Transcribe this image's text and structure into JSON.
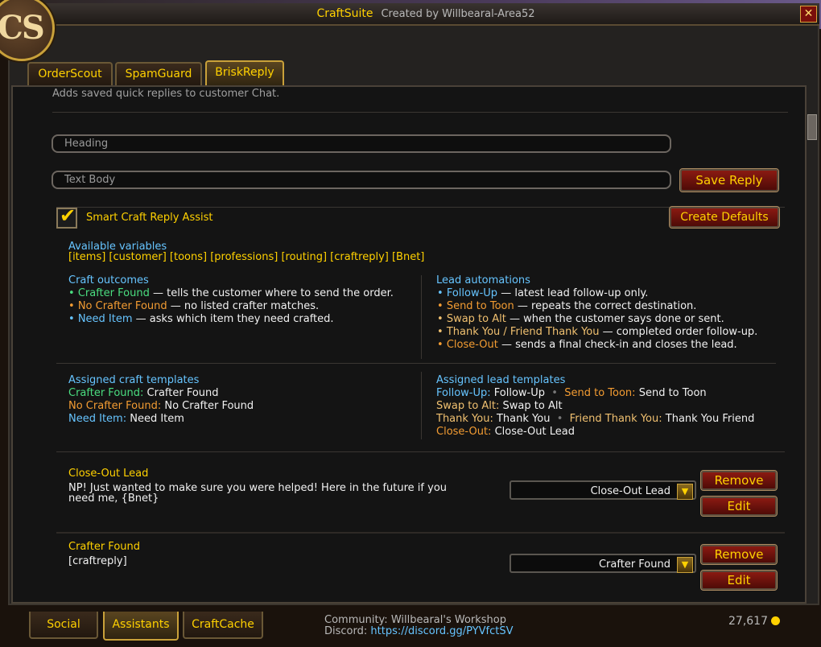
{
  "window": {
    "app_name": "CraftSuite",
    "subtitle": "Created by Willbearal-Area52",
    "logo_text": "CS",
    "close_symbol": "✕"
  },
  "tabs": [
    {
      "label": "OrderScout"
    },
    {
      "label": "SpamGuard"
    },
    {
      "label": "BriskReply"
    }
  ],
  "description": "Adds saved quick replies to customer Chat.",
  "editor": {
    "heading_placeholder": "Heading",
    "body_placeholder": "Text Body",
    "save_label": "Save Reply"
  },
  "smart_assist": {
    "label": "Smart Craft Reply Assist",
    "checked": true,
    "create_defaults_label": "Create Defaults"
  },
  "variables": {
    "title": "Available variables",
    "list": "[items]  [customer]  [toons]  [professions]  [routing]  [craftreply]  [Bnet]"
  },
  "craft_outcomes": {
    "title": "Craft outcomes",
    "items": [
      {
        "name": "Crafter Found",
        "desc": "— tells the customer where to send the order."
      },
      {
        "name": "No Crafter Found",
        "desc": "— no listed crafter matches."
      },
      {
        "name": "Need Item",
        "desc": "— asks which item they need crafted."
      }
    ]
  },
  "lead_automations": {
    "title": "Lead automations",
    "items": [
      {
        "name": "Follow-Up",
        "desc": "— latest lead follow-up only."
      },
      {
        "name": "Send to Toon",
        "desc": "— repeats the correct destination."
      },
      {
        "name": "Swap to Alt",
        "desc": "— when the customer says done or sent."
      },
      {
        "name": "Thank You / Friend Thank You",
        "desc": "— completed order follow-up."
      },
      {
        "name": "Close-Out",
        "desc": "— sends a final check-in and closes the lead."
      }
    ]
  },
  "assigned_craft": {
    "title": "Assigned craft templates",
    "rows": [
      {
        "key": "Crafter Found:",
        "value": "Crafter Found"
      },
      {
        "key": "No Crafter Found:",
        "value": "No Crafter Found"
      },
      {
        "key": "Need Item:",
        "value": "Need Item"
      }
    ]
  },
  "assigned_lead": {
    "title": "Assigned lead templates",
    "row1_k1": "Follow-Up:",
    "row1_v1": "Follow-Up",
    "row1_k2": "Send to Toon:",
    "row1_v2": "Send to Toon",
    "row2_k1": "Swap to Alt:",
    "row2_v1": "Swap to Alt",
    "row3_k1": "Thank You:",
    "row3_v1": "Thank You",
    "row3_k2": "Friend Thank You:",
    "row3_v2": "Thank You Friend",
    "row4_k1": "Close-Out:",
    "row4_v1": "Close-Out Lead"
  },
  "saved_replies": [
    {
      "title": "Close-Out Lead",
      "body_line1": "NP! Just wanted to make sure you were helped! Here in the future if you",
      "body_line2": "need me, {Bnet}",
      "dropdown": "Close-Out Lead",
      "remove_label": "Remove",
      "edit_label": "Edit"
    },
    {
      "title": "Crafter Found",
      "body_line1": "[craftreply]",
      "body_line2": "",
      "dropdown": "Crafter Found",
      "remove_label": "Remove",
      "edit_label": "Edit"
    }
  ],
  "bottom_tabs": [
    {
      "label": "Social"
    },
    {
      "label": "Assistants"
    },
    {
      "label": "CraftCache"
    }
  ],
  "footer": {
    "community_label": "Community:",
    "community_value": "Willbearal's Workshop",
    "discord_label": "Discord:",
    "discord_link": "https://discord.gg/PYVfctSV",
    "gold": "27,617"
  },
  "icons": {
    "check": "check-icon",
    "dropdown": "chevron-down-icon",
    "gold_coin": "gold-coin-icon",
    "close": "close-icon"
  },
  "colors": {
    "accent_gold": "#ffd100",
    "button_red": "#8a1a12",
    "link_blue": "#66c4ff",
    "green": "#4ade80",
    "orange": "#f39c32"
  }
}
